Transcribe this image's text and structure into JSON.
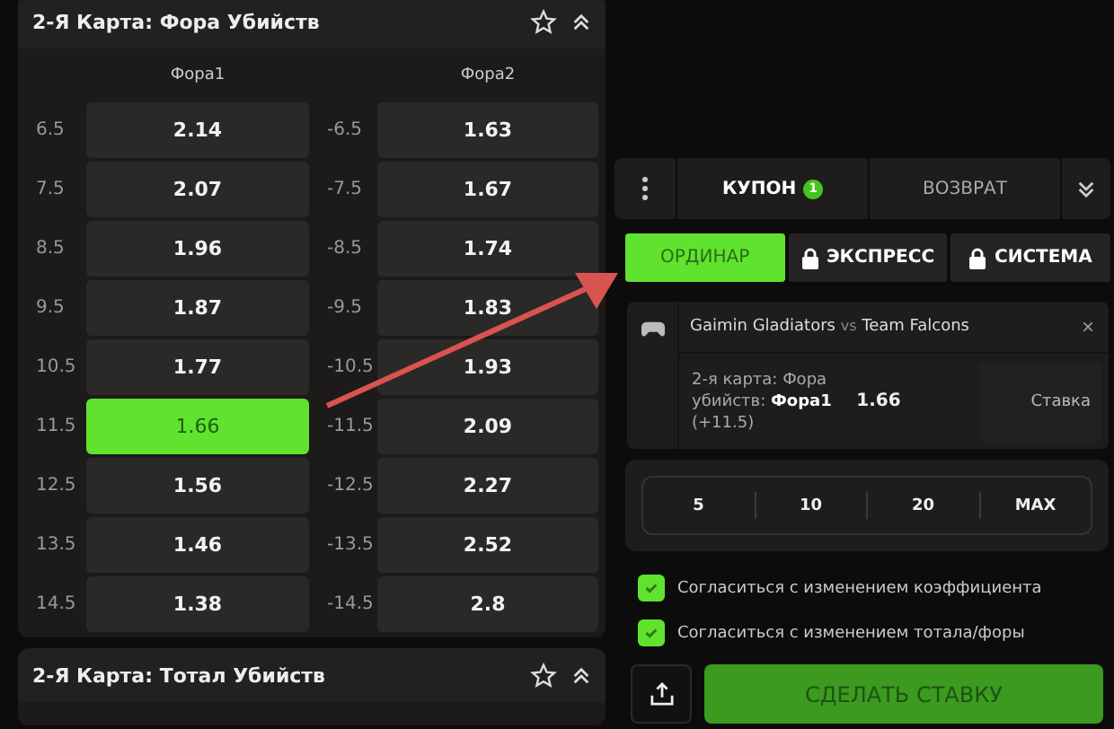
{
  "markets": [
    {
      "title": "2-Я Карта: Фора Убийств",
      "columns": [
        "Фора1",
        "Фора2"
      ],
      "rows": [
        {
          "line1": "6.5",
          "odds1": {
            "value": "2.14",
            "selected": false
          },
          "line2": "-6.5",
          "odds2": {
            "value": "1.63",
            "selected": false
          }
        },
        {
          "line1": "7.5",
          "odds1": {
            "value": "2.07",
            "selected": false
          },
          "line2": "-7.5",
          "odds2": {
            "value": "1.67",
            "selected": false
          }
        },
        {
          "line1": "8.5",
          "odds1": {
            "value": "1.96",
            "selected": false
          },
          "line2": "-8.5",
          "odds2": {
            "value": "1.74",
            "selected": false
          }
        },
        {
          "line1": "9.5",
          "odds1": {
            "value": "1.87",
            "selected": false
          },
          "line2": "-9.5",
          "odds2": {
            "value": "1.83",
            "selected": false
          }
        },
        {
          "line1": "10.5",
          "odds1": {
            "value": "1.77",
            "selected": false
          },
          "line2": "-10.5",
          "odds2": {
            "value": "1.93",
            "selected": false
          }
        },
        {
          "line1": "11.5",
          "odds1": {
            "value": "1.66",
            "selected": true
          },
          "line2": "-11.5",
          "odds2": {
            "value": "2.09",
            "selected": false
          }
        },
        {
          "line1": "12.5",
          "odds1": {
            "value": "1.56",
            "selected": false
          },
          "line2": "-12.5",
          "odds2": {
            "value": "2.27",
            "selected": false
          }
        },
        {
          "line1": "13.5",
          "odds1": {
            "value": "1.46",
            "selected": false
          },
          "line2": "-13.5",
          "odds2": {
            "value": "2.52",
            "selected": false
          }
        },
        {
          "line1": "14.5",
          "odds1": {
            "value": "1.38",
            "selected": false
          },
          "line2": "-14.5",
          "odds2": {
            "value": "2.8",
            "selected": false
          }
        }
      ]
    },
    {
      "title": "2-Я Карта: Тотал Убийств"
    }
  ],
  "coupon": {
    "tabs": [
      {
        "label": "КУПОН",
        "badge": "1",
        "selected": true
      },
      {
        "label": "ВОЗВРАТ",
        "selected": false
      }
    ],
    "bet_types": [
      {
        "label": "ОРДИНАР",
        "selected": true,
        "locked": false
      },
      {
        "label": "ЭКСПРЕСС",
        "selected": false,
        "locked": true
      },
      {
        "label": "СИСТЕМА",
        "selected": false,
        "locked": true
      }
    ],
    "bet": {
      "team1": "Gaimin Gladiators",
      "vs": "vs",
      "team2": "Team Falcons",
      "market": "2-я карта: Фора убийств: **Фора1** (+11.5)",
      "odds": "1.66",
      "stake_placeholder": "Ставка",
      "close": "×"
    },
    "quick_stakes": [
      "5",
      "10",
      "20",
      "MAX"
    ],
    "options": [
      {
        "label": "Согласиться с изменением коэффициента",
        "checked": true
      },
      {
        "label": "Согласиться с изменением тотала/форы",
        "checked": true
      }
    ],
    "submit": "СДЕЛАТЬ СТАВКУ"
  }
}
